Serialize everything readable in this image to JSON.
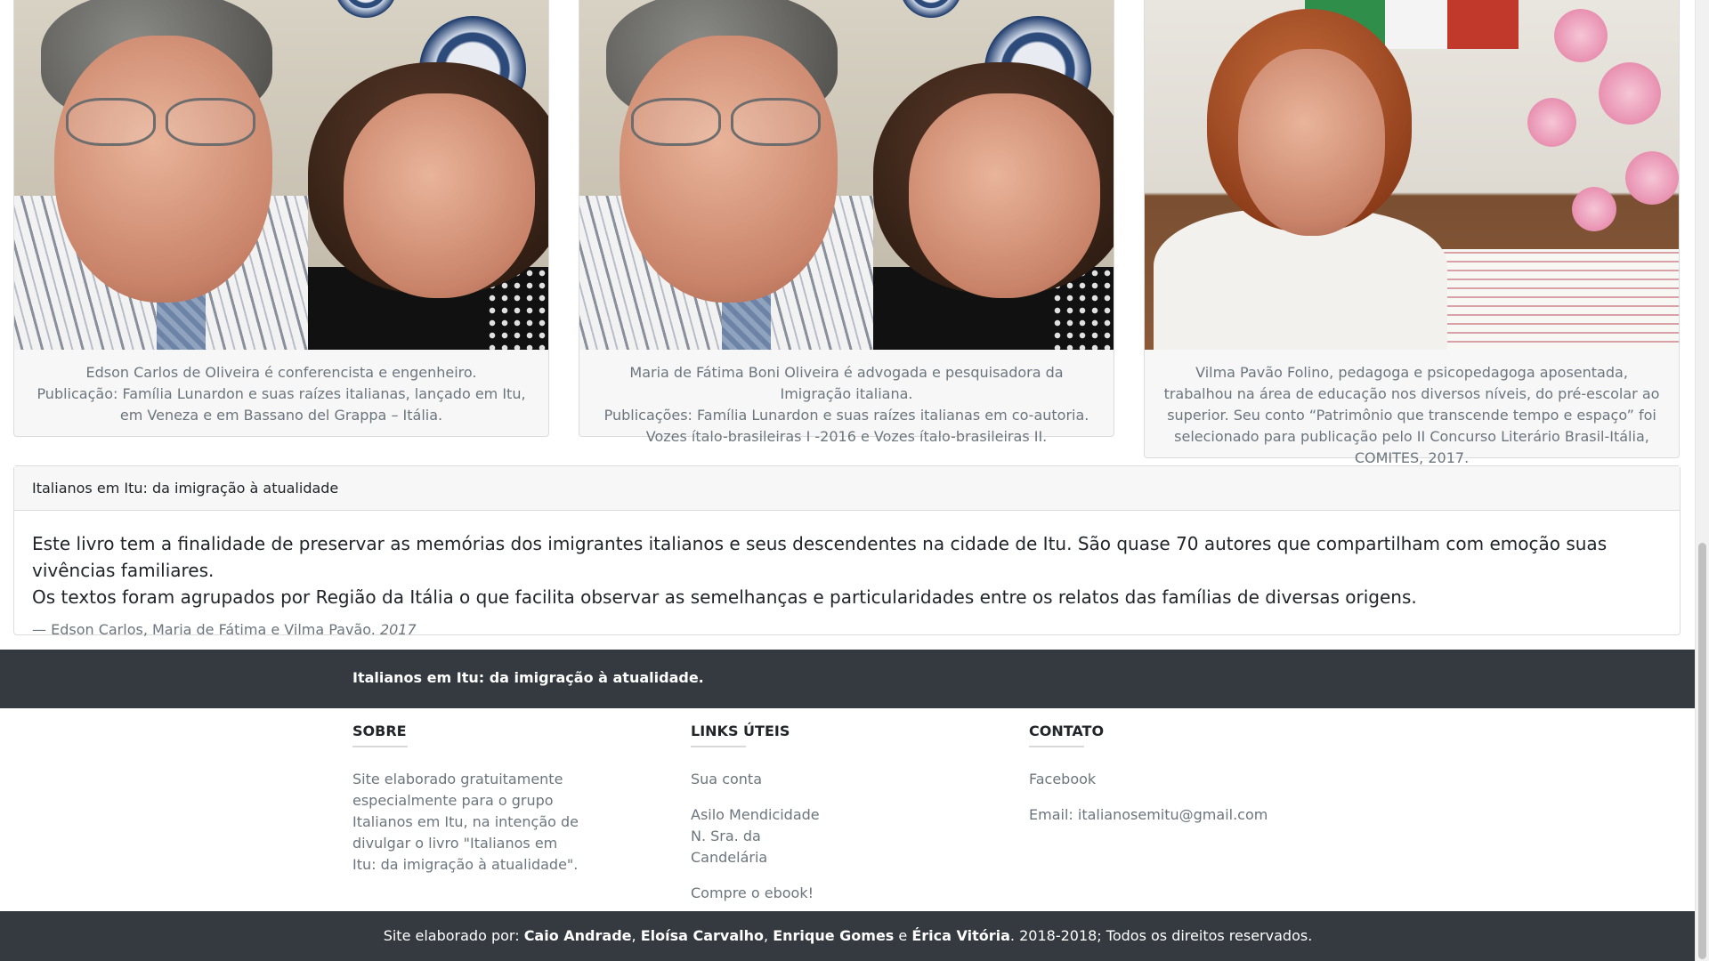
{
  "cards": [
    {
      "caption_line1": "Edson Carlos de Oliveira é conferencista e engenheiro.",
      "caption_line2": "Publicação: Família Lunardon e suas raízes italianas, lançado em Itu, em Veneza e em Bassano del Grappa – Itália."
    },
    {
      "caption_line1": "Maria de Fátima Boni Oliveira é advogada e pesquisadora da Imigração italiana.",
      "caption_line2": "Publicações: Família Lunardon e suas raízes italianas em co-autoria. Vozes ítalo-brasileiras I -2016 e Vozes ítalo-brasileiras II."
    },
    {
      "caption_line1": "Vilma Pavão Folino, pedagoga e psicopedagoga aposentada, trabalhou na área de educação nos diversos níveis, do pré-escolar ao superior. Seu conto “Patrimônio que transcende tempo e espaço” foi selecionado para publicação pelo II Concurso Literário Brasil-Itália, COMITES, 2017."
    }
  ],
  "panel": {
    "header": "Italianos em Itu: da imigração à atualidade",
    "quote_line1": "Este livro tem a finalidade de preservar as memórias dos imigrantes italianos e seus descendentes na cidade de Itu. São quase 70 autores que compartilham com emoção suas vivências familiares.",
    "quote_line2": "Os textos foram agrupados por Região da Itália o que facilita observar as semelhanças e particularidades entre os relatos das famílias de diversas origens.",
    "attribution": "— Edson Carlos, Maria de Fátima e Vilma Pavão.",
    "year": "2017"
  },
  "footer": {
    "title": "Italianos em Itu: da imigração à atualidade.",
    "sobre": {
      "heading": "Sobre",
      "text": "Site elaborado gratuitamente especialmente para o grupo Italianos em Itu, na intenção de divulgar o livro \"Italianos em Itu: da imigração à atualidade\"."
    },
    "links": {
      "heading": "Links úteis",
      "items": [
        "Sua conta",
        "Asilo Mendicidade N. Sra. da Candelária",
        "Compre o ebook!"
      ]
    },
    "contato": {
      "heading": "Contato",
      "items": [
        "Facebook",
        "Email: italianosemitu@gmail.com"
      ]
    },
    "credits": {
      "prefix": "Site elaborado por:",
      "author1": "Caio Andrade",
      "sep1": ",",
      "author2": "Eloísa Carvalho",
      "sep2": ",",
      "author3": "Enrique Gomes",
      "and": "e",
      "author4": "Érica Vitória",
      "suffix": ". 2018-2018; Todos os direitos reservados."
    }
  }
}
